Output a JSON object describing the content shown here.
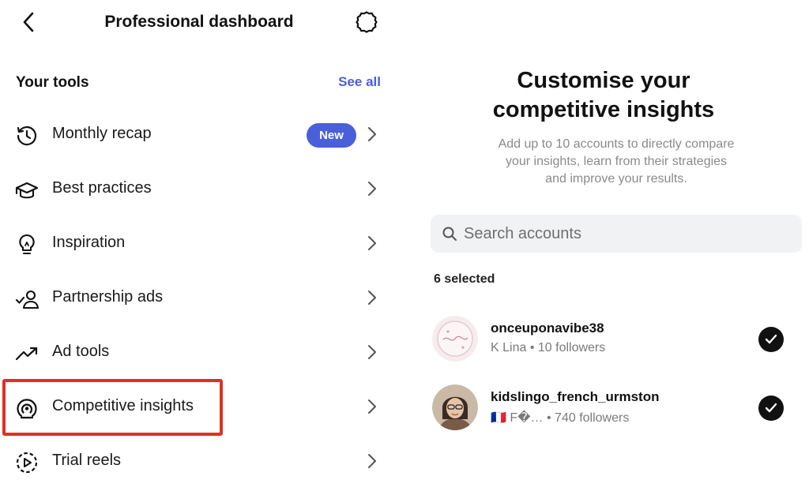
{
  "header": {
    "title": "Professional dashboard",
    "back_icon": "chevron-left-icon",
    "settings_icon": "gear-icon"
  },
  "tools": {
    "title": "Your tools",
    "see_all": "See all",
    "items": [
      {
        "label": "Monthly recap",
        "icon": "history-icon",
        "badge": "New"
      },
      {
        "label": "Best practices",
        "icon": "graduation-cap-icon"
      },
      {
        "label": "Inspiration",
        "icon": "lightbulb-icon"
      },
      {
        "label": "Partnership ads",
        "icon": "partnership-icon"
      },
      {
        "label": "Ad tools",
        "icon": "trending-up-icon"
      },
      {
        "label": "Competitive insights",
        "icon": "radar-icon",
        "highlighted": true
      },
      {
        "label": "Trial reels",
        "icon": "trial-reels-icon"
      }
    ]
  },
  "panel": {
    "title_line1": "Customise your",
    "title_line2": "competitive insights",
    "subtitle_line1": "Add up to 10 accounts to directly compare",
    "subtitle_line2": "your insights, learn from their strategies",
    "subtitle_line3": "and improve your results.",
    "search_placeholder": "Search accounts",
    "selected_label": "6 selected",
    "accounts": [
      {
        "username": "onceuponavibe38",
        "display_name": "K Lina",
        "followers": "10 followers",
        "selected": true
      },
      {
        "username": "kidslingo_french_urmston",
        "display_name": "🇫🇷 F�…",
        "followers": "740 followers",
        "selected": true
      }
    ]
  },
  "colors": {
    "accent": "#4a5fd9",
    "highlight": "#e0311f",
    "muted": "#8a8a8a",
    "search_bg": "#f1f2f4"
  }
}
